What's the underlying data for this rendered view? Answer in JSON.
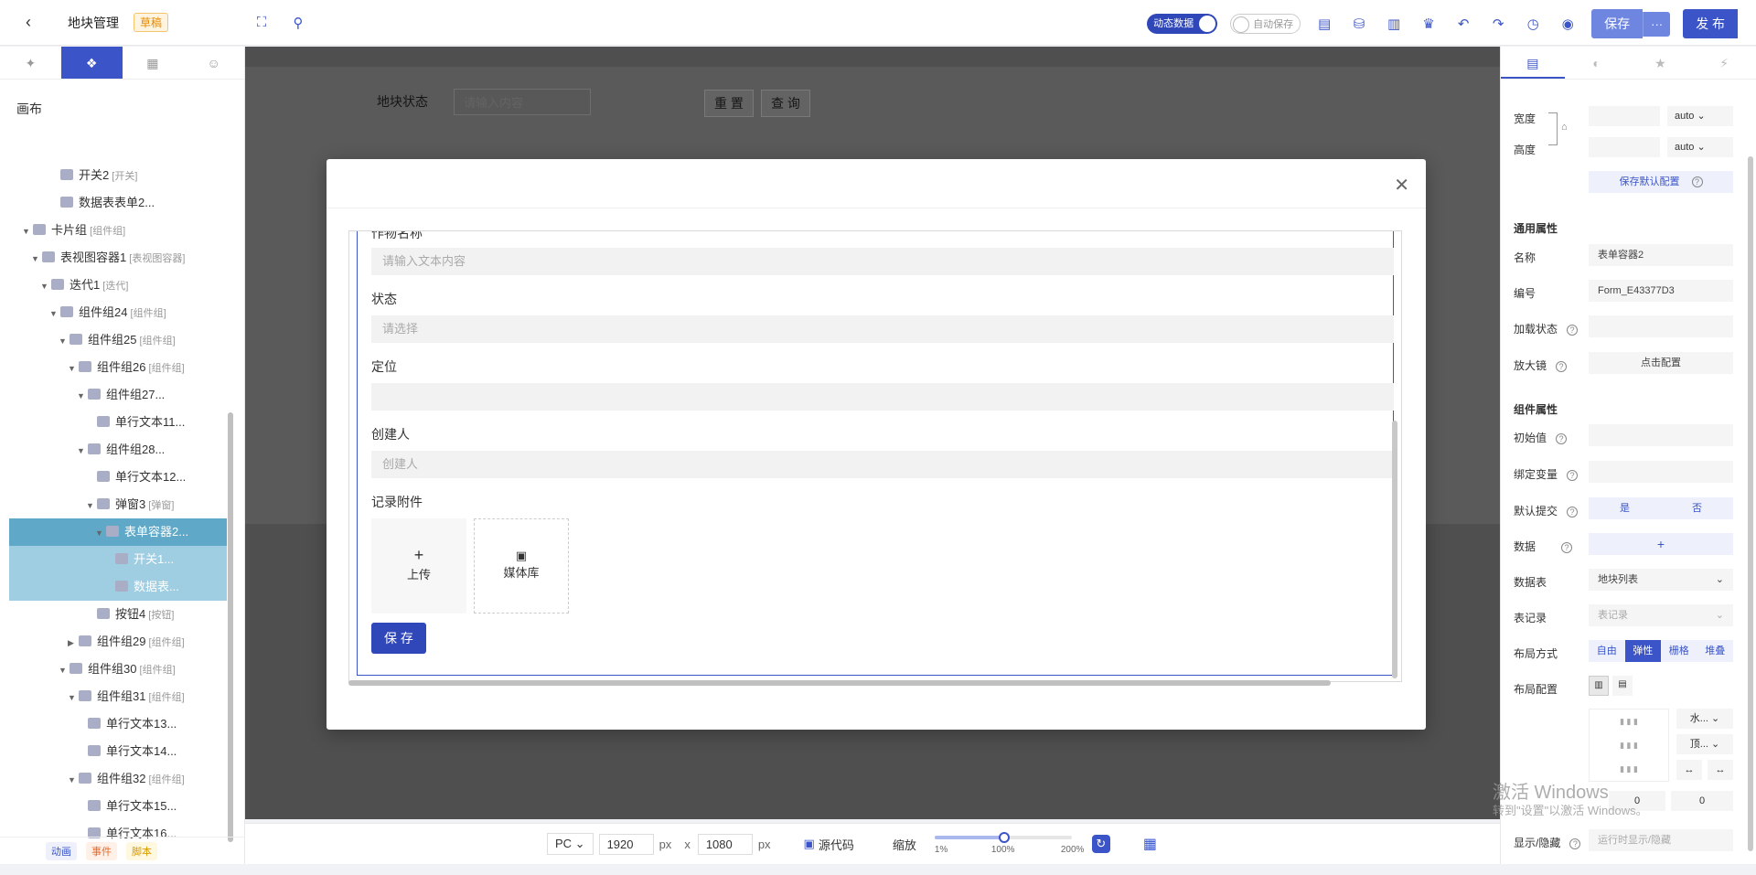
{
  "header": {
    "title": "地块管理",
    "draft_badge": "草稿",
    "dynamic_data_label": "动态数据",
    "auto_save_label": "自动保存",
    "save_label": "保存",
    "more_label": "···",
    "publish_label": "发 布"
  },
  "left": {
    "canvas_label": "画布",
    "tree": [
      {
        "label": "开关2",
        "tag": "[开关]",
        "indent": 4
      },
      {
        "label": "数据表表单2...",
        "tag": "",
        "indent": 4
      },
      {
        "label": "卡片组",
        "tag": "[组件组]",
        "indent": 1,
        "arrow": "▼"
      },
      {
        "label": "表视图容器1",
        "tag": "[表视图容器]",
        "indent": 2,
        "arrow": "▼"
      },
      {
        "label": "迭代1",
        "tag": "[迭代]",
        "indent": 3,
        "arrow": "▼"
      },
      {
        "label": "组件组24",
        "tag": "[组件组]",
        "indent": 4,
        "arrow": "▼"
      },
      {
        "label": "组件组25",
        "tag": "[组件组]",
        "indent": 5,
        "arrow": "▼"
      },
      {
        "label": "组件组26",
        "tag": "[组件组]",
        "indent": 6,
        "arrow": "▼"
      },
      {
        "label": "组件组27...",
        "tag": "",
        "indent": 7,
        "arrow": "▼"
      },
      {
        "label": "单行文本11...",
        "tag": "",
        "indent": 8
      },
      {
        "label": "组件组28...",
        "tag": "",
        "indent": 7,
        "arrow": "▼"
      },
      {
        "label": "单行文本12...",
        "tag": "",
        "indent": 8
      },
      {
        "label": "弹窗3",
        "tag": "[弹窗]",
        "indent": 8,
        "arrow": "▼"
      },
      {
        "label": "表单容器2...",
        "tag": "",
        "indent": 9,
        "arrow": "▼",
        "sel": 1
      },
      {
        "label": "开关1...",
        "tag": "",
        "indent": 10,
        "sel": 2
      },
      {
        "label": "数据表...",
        "tag": "",
        "indent": 10,
        "sel": 2
      },
      {
        "label": "按钮4",
        "tag": "[按钮]",
        "indent": 8
      },
      {
        "label": "组件组29",
        "tag": "[组件组]",
        "indent": 6,
        "arrow": "▶"
      },
      {
        "label": "组件组30",
        "tag": "[组件组]",
        "indent": 5,
        "arrow": "▼"
      },
      {
        "label": "组件组31",
        "tag": "[组件组]",
        "indent": 6,
        "arrow": "▼"
      },
      {
        "label": "单行文本13...",
        "tag": "",
        "indent": 7
      },
      {
        "label": "单行文本14...",
        "tag": "",
        "indent": 7
      },
      {
        "label": "组件组32",
        "tag": "[组件组]",
        "indent": 6,
        "arrow": "▼"
      },
      {
        "label": "单行文本15...",
        "tag": "",
        "indent": 7
      },
      {
        "label": "单行文本16...",
        "tag": "",
        "indent": 7
      }
    ],
    "bottom_tags": [
      "动画",
      "事件",
      "脚本"
    ]
  },
  "stage": {
    "bg_status_label": "地块状态",
    "bg_input_placeholder": "请输入内容",
    "bg_reset": "重 置",
    "bg_query": "查 询"
  },
  "form": {
    "fields": [
      {
        "label": "作物名称",
        "placeholder": "请输入文本内容"
      },
      {
        "label": "状态",
        "placeholder": "请选择"
      },
      {
        "label": "定位",
        "placeholder": ""
      },
      {
        "label": "创建人",
        "placeholder": "创建人"
      }
    ],
    "attach_label": "记录附件",
    "upload_label": "上传",
    "media_label": "媒体库",
    "save_label": "保 存"
  },
  "bottom": {
    "device": "PC",
    "width": "1920",
    "height": "1080",
    "px": "px",
    "x": "x",
    "source": "源代码",
    "zoom": "缩放",
    "zoom_min": "1%",
    "zoom_mid": "100%",
    "zoom_max": "200%"
  },
  "right": {
    "width_label": "宽度",
    "height_label": "高度",
    "auto": "auto",
    "save_default": "保存默认配置",
    "common_section": "通用属性",
    "name_label": "名称",
    "name_value": "表单容器2",
    "id_label": "编号",
    "id_value": "Form_E43377D3",
    "load_label": "加载状态",
    "magnifier_label": "放大镜",
    "magnifier_value": "点击配置",
    "comp_section": "组件属性",
    "init_label": "初始值",
    "bind_label": "绑定变量",
    "submit_label": "默认提交",
    "yes": "是",
    "no": "否",
    "data_label": "数据",
    "plus": "+",
    "table_label": "数据表",
    "table_value": "地块列表",
    "record_label": "表记录",
    "record_value": "表记录",
    "layout_label": "布局方式",
    "layout_opts": [
      "自由",
      "弹性",
      "栅格",
      "堆叠"
    ],
    "layout_cfg_label": "布局配置",
    "h_align": "水...",
    "v_align": "顶...",
    "gap_a": "0",
    "gap_b": "0",
    "visibility_label": "显示/隐藏",
    "visibility_value": "运行时显示/隐藏"
  },
  "watermark": {
    "line1": "激活 Windows",
    "line2": "转到\"设置\"以激活 Windows。"
  }
}
